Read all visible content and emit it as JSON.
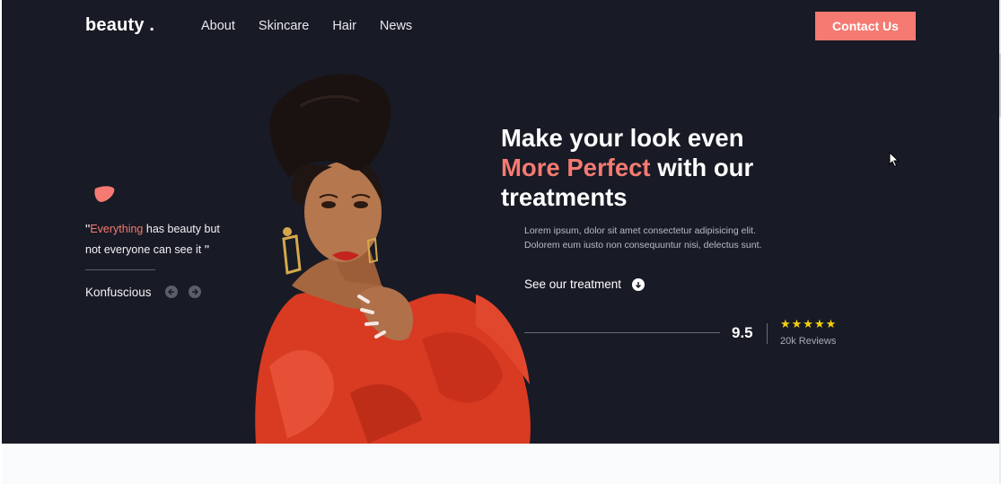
{
  "brand": {
    "logo": "beauty ."
  },
  "nav": {
    "items": [
      "About",
      "Skincare",
      "Hair",
      "News"
    ],
    "cta_label": "Contact Us"
  },
  "quote": {
    "open_mark": "\"",
    "highlight": "Everything",
    "rest": " has beauty but not everyone can see it ",
    "close_mark": "\"",
    "author": "Konfuscious"
  },
  "hero": {
    "headline_line1": "Make your look even",
    "headline_accent": "More Perfect",
    "headline_mid": " with our",
    "headline_line3": "treatments",
    "description": "Lorem ipsum, dolor sit amet consectetur adipisicing elit. Dolorem eum iusto non consequuntur nisi, delectus sunt.",
    "cta_label": "See our treatment"
  },
  "rating": {
    "score": "9.5",
    "stars": "★★★★★",
    "star_count": 5,
    "reviews_label": "20k Reviews"
  },
  "colors": {
    "background": "#181a25",
    "accent": "#f47a72",
    "star": "#f4d010"
  },
  "icons": [
    "blob-shape",
    "arrow-left-icon",
    "arrow-right-icon",
    "arrow-down-circle-icon",
    "mouse-cursor-icon"
  ]
}
